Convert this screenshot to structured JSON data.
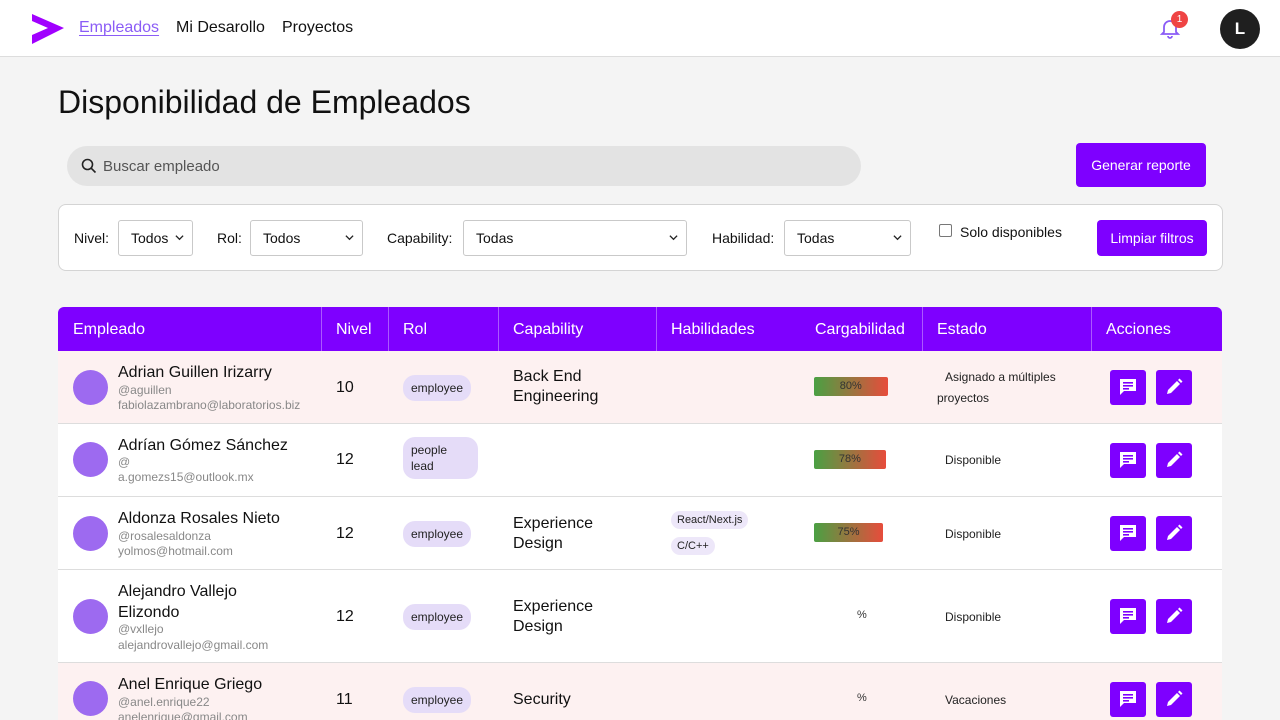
{
  "nav": {
    "links": [
      "Empleados",
      "Mi Desarollo",
      "Proyectos"
    ],
    "notification_count": "1",
    "user_initial": "L"
  },
  "page": {
    "title": "Disponibilidad de Empleados"
  },
  "search": {
    "placeholder": "Buscar empleado"
  },
  "actions": {
    "report_label": "Generar reporte",
    "clear_label": "Limpiar filtros"
  },
  "filters": {
    "nivel": {
      "label": "Nivel:",
      "value": "Todos"
    },
    "rol": {
      "label": "Rol:",
      "value": "Todos"
    },
    "capability": {
      "label": "Capability:",
      "value": "Todas"
    },
    "habilidad": {
      "label": "Habilidad:",
      "value": "Todas"
    },
    "disponibles": {
      "label": "Solo disponibles",
      "checked": false
    }
  },
  "table": {
    "headers": [
      "Empleado",
      "Nivel",
      "Rol",
      "Capability",
      "Habilidades",
      "Cargabilidad",
      "Estado",
      "Acciones"
    ],
    "rows": [
      {
        "name": "Adrian Guillen Irizarry",
        "username": "@aguillen",
        "email": "fabiolazambrano@laboratorios.biz",
        "nivel": "10",
        "rol": "employee",
        "capability": "Back End Engineering",
        "skills": [],
        "cargabilidad": "80%",
        "carga_pct": 80,
        "estado": "Asignado a múltiples proyectos"
      },
      {
        "name": "Adrían Gómez Sánchez",
        "username": "@",
        "email": "a.gomezs15@outlook.mx",
        "nivel": "12",
        "rol": "people lead",
        "capability": "",
        "skills": [],
        "cargabilidad": "78%",
        "carga_pct": 78,
        "estado": "Disponible"
      },
      {
        "name": "Aldonza Rosales Nieto",
        "username": "@rosalesaldonza",
        "email": "yolmos@hotmail.com",
        "nivel": "12",
        "rol": "employee",
        "capability": "Experience Design",
        "skills": [
          "React/Next.js",
          "C/C++"
        ],
        "cargabilidad": "75%",
        "carga_pct": 75,
        "estado": "Disponible"
      },
      {
        "name": "Alejandro Vallejo Elizondo",
        "username": "@vxllejo",
        "email": "alejandrovallejo@gmail.com",
        "nivel": "12",
        "rol": "employee",
        "capability": "Experience Design",
        "skills": [],
        "cargabilidad": "%",
        "estado": "Disponible"
      },
      {
        "name": "Anel Enrique Griego",
        "username": "@anel.enrique22",
        "email": "anelenrique@gmail.com",
        "nivel": "11",
        "rol": "employee",
        "capability": "Security",
        "skills": [],
        "cargabilidad": "%",
        "estado": "Vacaciones"
      }
    ]
  },
  "colors": {
    "accent": "#7e00ff",
    "accent_light": "#8b5cf6",
    "badge": "#ef4444"
  },
  "icons": [
    "logo-icon",
    "bell-icon",
    "search-icon",
    "chevron-down-icon",
    "comment-icon",
    "edit-icon"
  ]
}
